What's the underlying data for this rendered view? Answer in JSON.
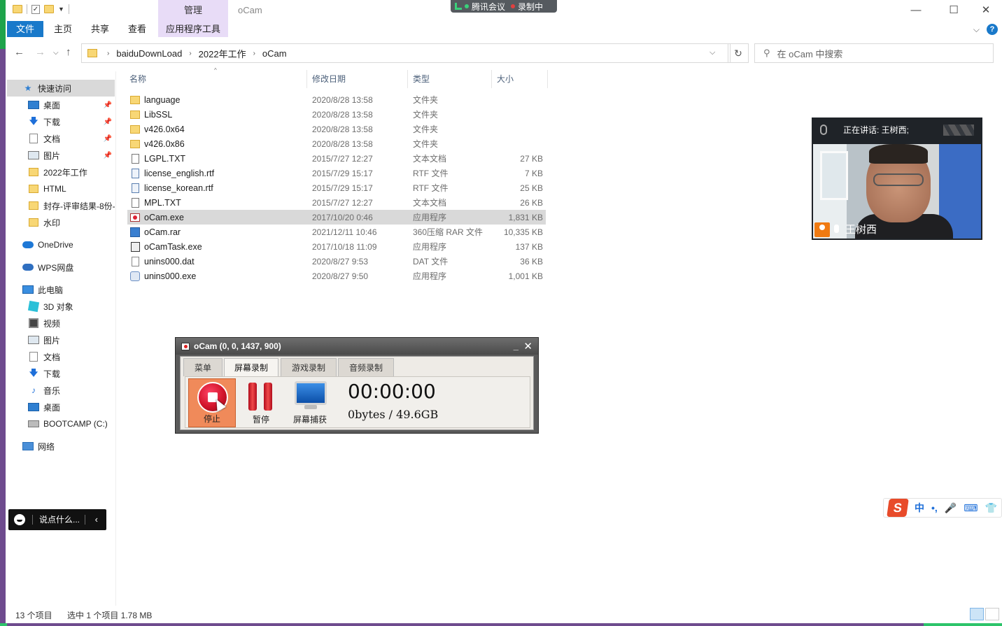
{
  "window": {
    "title": "oCam",
    "manage_tab": "管理",
    "minimize": "—",
    "maximize": "☐",
    "close": "✕"
  },
  "meeting_bar": {
    "app_name": "腾讯会议",
    "recording": "录制中"
  },
  "ribbon": {
    "tabs": [
      "文件",
      "主页",
      "共享",
      "查看",
      "应用程序工具"
    ],
    "help": "?"
  },
  "address_bar": {
    "crumbs": [
      "baiduDownLoad",
      "2022年工作",
      "oCam"
    ],
    "search_placeholder": "在 oCam 中搜索"
  },
  "nav_pane": {
    "items": [
      {
        "label": "快速访问",
        "icon": "star-icon"
      },
      {
        "label": "桌面",
        "icon": "desktop-icon",
        "pinned": true
      },
      {
        "label": "下载",
        "icon": "download-icon",
        "pinned": true
      },
      {
        "label": "文档",
        "icon": "document-icon",
        "pinned": true
      },
      {
        "label": "图片",
        "icon": "picture-icon",
        "pinned": true
      },
      {
        "label": "2022年工作",
        "icon": "folder-icon"
      },
      {
        "label": "HTML",
        "icon": "folder-icon"
      },
      {
        "label": "封存-评审结果-8份-",
        "icon": "folder-icon"
      },
      {
        "label": "水印",
        "icon": "folder-icon"
      },
      {
        "label": "OneDrive",
        "icon": "onedrive-icon"
      },
      {
        "label": "WPS网盘",
        "icon": "wps-cloud-icon"
      },
      {
        "label": "此电脑",
        "icon": "this-pc-icon"
      },
      {
        "label": "3D 对象",
        "icon": "3d-objects-icon"
      },
      {
        "label": "视频",
        "icon": "video-icon"
      },
      {
        "label": "图片",
        "icon": "picture-icon"
      },
      {
        "label": "文档",
        "icon": "document-icon"
      },
      {
        "label": "下载",
        "icon": "download-icon"
      },
      {
        "label": "音乐",
        "icon": "music-icon"
      },
      {
        "label": "桌面",
        "icon": "desktop-icon"
      },
      {
        "label": "BOOTCAMP (C:)",
        "icon": "drive-icon"
      },
      {
        "label": "网络",
        "icon": "network-icon"
      }
    ]
  },
  "file_list": {
    "columns": [
      "名称",
      "修改日期",
      "类型",
      "大小"
    ],
    "rows": [
      {
        "name": "language",
        "date": "2020/8/28 13:58",
        "type": "文件夹",
        "size": "",
        "icon": "folder-icon"
      },
      {
        "name": "LibSSL",
        "date": "2020/8/28 13:58",
        "type": "文件夹",
        "size": "",
        "icon": "folder-icon"
      },
      {
        "name": "v426.0x64",
        "date": "2020/8/28 13:58",
        "type": "文件夹",
        "size": "",
        "icon": "folder-icon"
      },
      {
        "name": "v426.0x86",
        "date": "2020/8/28 13:58",
        "type": "文件夹",
        "size": "",
        "icon": "folder-icon"
      },
      {
        "name": "LGPL.TXT",
        "date": "2015/7/27 12:27",
        "type": "文本文档",
        "size": "27 KB",
        "icon": "text-file-icon"
      },
      {
        "name": "license_english.rtf",
        "date": "2015/7/29 15:17",
        "type": "RTF 文件",
        "size": "7 KB",
        "icon": "rtf-file-icon"
      },
      {
        "name": "license_korean.rtf",
        "date": "2015/7/29 15:17",
        "type": "RTF 文件",
        "size": "25 KB",
        "icon": "rtf-file-icon"
      },
      {
        "name": "MPL.TXT",
        "date": "2015/7/27 12:27",
        "type": "文本文档",
        "size": "26 KB",
        "icon": "text-file-icon"
      },
      {
        "name": "oCam.exe",
        "date": "2017/10/20 0:46",
        "type": "应用程序",
        "size": "1,831 KB",
        "icon": "ocam-exe-icon",
        "selected": true
      },
      {
        "name": "oCam.rar",
        "date": "2021/12/11 10:46",
        "type": "360压缩 RAR 文件",
        "size": "10,335 KB",
        "icon": "rar-file-icon"
      },
      {
        "name": "oCamTask.exe",
        "date": "2017/10/18 11:09",
        "type": "应用程序",
        "size": "137 KB",
        "icon": "task-exe-icon"
      },
      {
        "name": "unins000.dat",
        "date": "2020/8/27 9:53",
        "type": "DAT 文件",
        "size": "36 KB",
        "icon": "dat-file-icon"
      },
      {
        "name": "unins000.exe",
        "date": "2020/8/27 9:50",
        "type": "应用程序",
        "size": "1,001 KB",
        "icon": "uninstall-exe-icon"
      }
    ]
  },
  "status_bar": {
    "item_count": "13 个项目",
    "selection": "选中 1 个项目  1.78 MB"
  },
  "ocam": {
    "title": "oCam (0, 0, 1437, 900)",
    "tabs": [
      "菜单",
      "屏幕录制",
      "游戏录制",
      "音频录制"
    ],
    "active_tab": "屏幕录制",
    "buttons": {
      "stop": "停止",
      "pause": "暂停",
      "capture": "屏幕捕获"
    },
    "timer": "00:00:00",
    "storage": "0bytes / 49.6GB"
  },
  "video_tile": {
    "speaking": "正在讲话: 王树西;",
    "name": "王树西"
  },
  "chat": {
    "placeholder": "说点什么..."
  },
  "ime": {
    "logo": "S",
    "items": [
      "中",
      "•,",
      "🎤",
      "⌨",
      "👕"
    ]
  },
  "colors": {
    "accent": "#1979ca",
    "manage_tab": "#e8dcf7",
    "selected_row": "#d9d9d9",
    "ocam_stop": "#f08a5a"
  }
}
